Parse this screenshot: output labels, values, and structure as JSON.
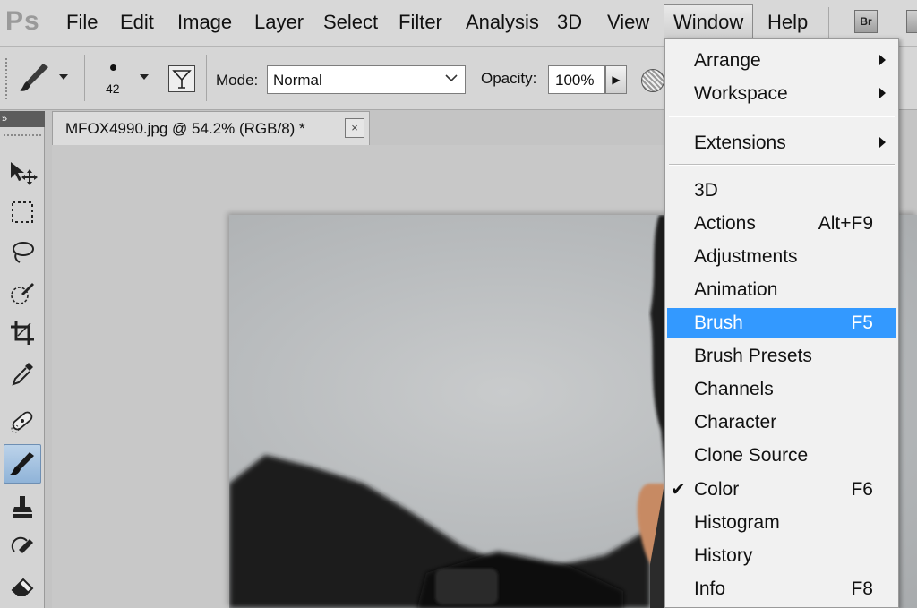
{
  "app": {
    "logo": "Ps"
  },
  "menubar": {
    "items": [
      "File",
      "Edit",
      "Image",
      "Layer",
      "Select",
      "Filter",
      "Analysis",
      "3D",
      "View",
      "Window",
      "Help"
    ],
    "active": "Window",
    "bridge_label": "Br"
  },
  "options": {
    "brush_size": "42",
    "mode_label": "Mode:",
    "mode_value": "Normal",
    "opacity_label": "Opacity:",
    "opacity_value": "100%"
  },
  "document": {
    "tab_title": "MFOX4990.jpg @ 54.2% (RGB/8) *",
    "close_glyph": "×"
  },
  "window_menu": {
    "items": [
      {
        "label": "Arrange",
        "submenu": true
      },
      {
        "label": "Workspace",
        "submenu": true
      },
      {
        "label": "Extensions",
        "submenu": true
      },
      {
        "label": "3D"
      },
      {
        "label": "Actions",
        "shortcut": "Alt+F9"
      },
      {
        "label": "Adjustments"
      },
      {
        "label": "Animation"
      },
      {
        "label": "Brush",
        "shortcut": "F5",
        "highlighted": true
      },
      {
        "label": "Brush Presets"
      },
      {
        "label": "Channels"
      },
      {
        "label": "Character"
      },
      {
        "label": "Clone Source"
      },
      {
        "label": "Color",
        "shortcut": "F6",
        "checked": true
      },
      {
        "label": "Histogram"
      },
      {
        "label": "History"
      },
      {
        "label": "Info",
        "shortcut": "F8"
      }
    ]
  },
  "toolbox": {
    "header_glyph": "»",
    "tools": [
      "move-tool",
      "marquee-tool",
      "lasso-tool",
      "quick-selection-tool",
      "crop-tool",
      "eyedropper-tool",
      "spot-healing-tool",
      "brush-tool",
      "clone-stamp-tool",
      "history-brush-tool",
      "eraser-tool"
    ],
    "selected": "brush-tool"
  },
  "colors": {
    "highlight": "#3399ff",
    "menu_bg": "#f1f1f1",
    "chrome": "#d6d6d6"
  }
}
